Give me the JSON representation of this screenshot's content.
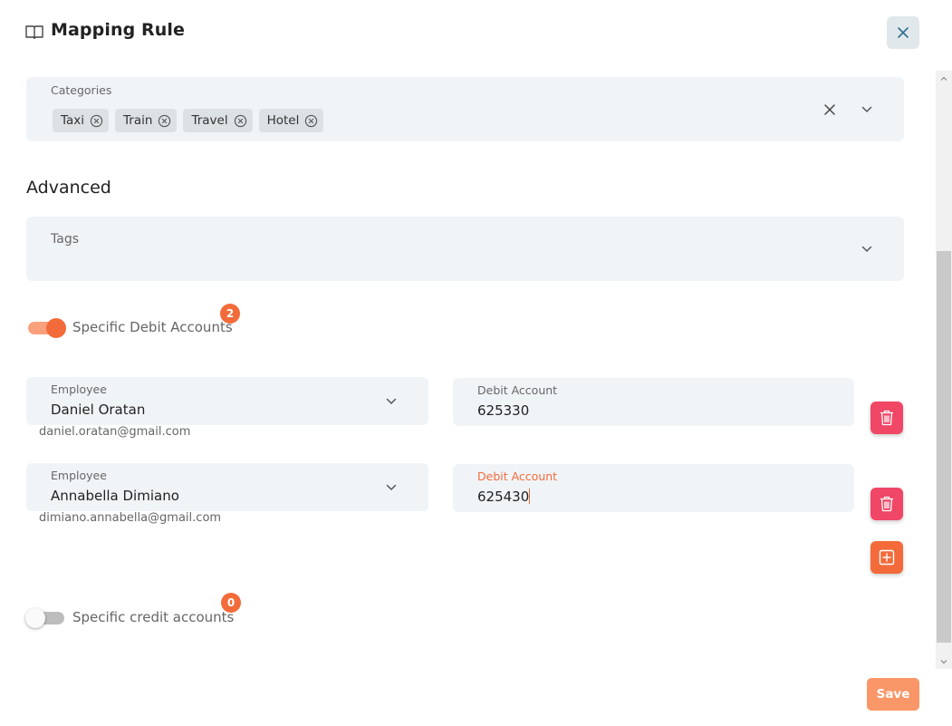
{
  "header": {
    "title": "Mapping Rule",
    "icon": "book-open-icon",
    "close_icon": "close-icon"
  },
  "categories": {
    "label": "Categories",
    "chips": [
      {
        "label": "Taxi"
      },
      {
        "label": "Train"
      },
      {
        "label": "Travel"
      },
      {
        "label": "Hotel"
      }
    ]
  },
  "advanced": {
    "title": "Advanced"
  },
  "tags": {
    "label": "Tags"
  },
  "debit_accounts": {
    "toggle_label": "Specific Debit Accounts",
    "enabled": true,
    "count": "2",
    "rows": [
      {
        "employee_label": "Employee",
        "employee": "Daniel Oratan",
        "email": "daniel.oratan@gmail.com",
        "account_label": "Debit Account",
        "account": "625330"
      },
      {
        "employee_label": "Employee",
        "employee": "Annabella Dimiano",
        "email": "dimiano.annabella@gmail.com",
        "account_label": "Debit Account",
        "account": "625430"
      }
    ]
  },
  "credit_accounts": {
    "toggle_label": "Specific credit accounts",
    "enabled": false,
    "count": "0"
  },
  "footer": {
    "save_label": "Save"
  },
  "colors": {
    "accent": "#f36b3a",
    "danger": "#f04766",
    "field_bg": "#f1f4f7",
    "save": "#f99768"
  }
}
